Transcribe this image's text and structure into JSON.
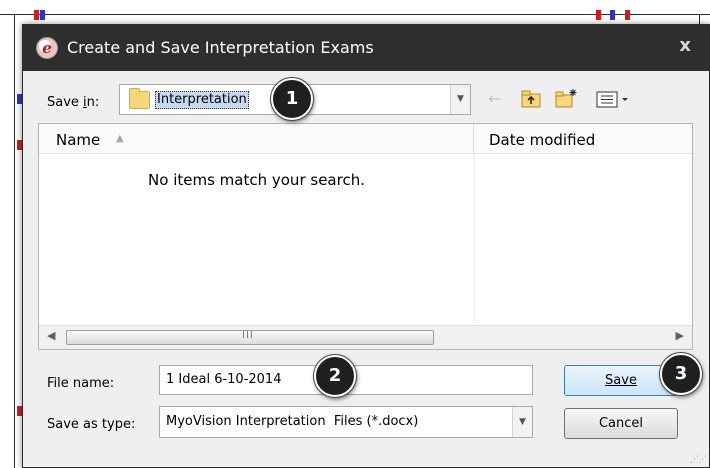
{
  "window": {
    "title": "Create and Save Interpretation Exams",
    "close_glyph": "x"
  },
  "save_in": {
    "label": "Save in:",
    "access_key": "i",
    "value": "Interpretation"
  },
  "file_list": {
    "columns": [
      "Name",
      "Date modified"
    ],
    "empty_message": "No items match your search.",
    "scroll_grip": "III"
  },
  "file_name": {
    "label": "File name:",
    "value": "1 Ideal 6-10-2014"
  },
  "save_as_type": {
    "label": "Save as type:",
    "value": "MyoVision Interpretation  Files (*.docx)"
  },
  "buttons": {
    "save": "Save",
    "cancel": "Cancel"
  },
  "callouts": [
    "1",
    "2",
    "3"
  ],
  "colors": {
    "titlebar": "#2e2e2e",
    "callout": "#1f1f1f",
    "selection": "#c7d9f0",
    "save_border": "#3c7fb1"
  }
}
